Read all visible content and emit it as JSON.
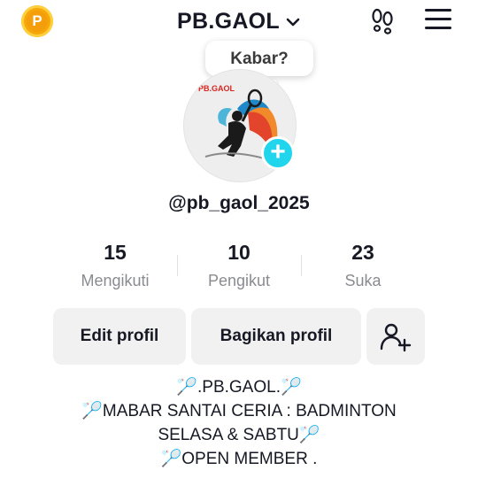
{
  "header": {
    "title": "PB.GAOL",
    "coin_icon": "P",
    "icons": [
      "coin-icon",
      "chevron-down-icon",
      "footprints-icon",
      "menu-icon"
    ]
  },
  "status_bubble": {
    "text": "Kabar?"
  },
  "avatar": {
    "logo_text": "PB.GAOL"
  },
  "profile": {
    "username": "@pb_gaol_2025"
  },
  "stats": [
    {
      "value": "15",
      "label": "Mengikuti"
    },
    {
      "value": "10",
      "label": "Pengikut"
    },
    {
      "value": "23",
      "label": "Suka"
    }
  ],
  "actions": {
    "edit_label": "Edit profil",
    "share_label": "Bagikan profil"
  },
  "bio": [
    "🏸.PB.GAOL.🏸",
    "🏸MABAR SANTAI CERIA : BADMINTON",
    "SELASA & SABTU🏸",
    "🏸OPEN MEMBER ."
  ],
  "colors": {
    "accent": "#20d5ec",
    "coin": "#f6a70a",
    "button_bg": "#f1f1f2",
    "muted_text": "#8a8b91"
  }
}
